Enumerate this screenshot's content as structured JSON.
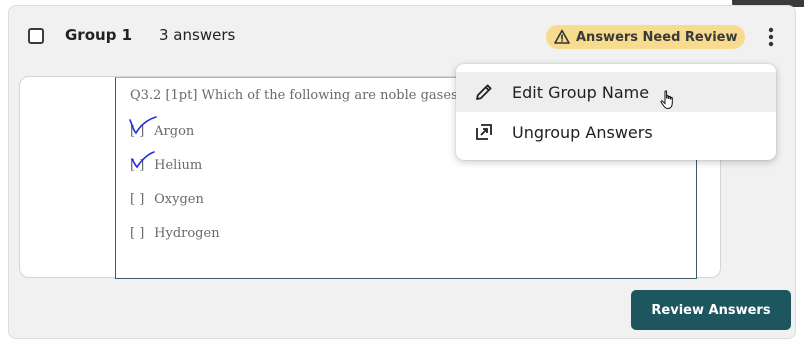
{
  "group": {
    "name": "Group 1",
    "answer_count": "3 answers",
    "status_badge": "Answers Need Review"
  },
  "answer": {
    "question": "Q3.2 [1pt]  Which of the following are noble gases?",
    "options": [
      {
        "box": "[ ]",
        "label": "Argon",
        "checked": true
      },
      {
        "box": "[ ]",
        "label": "Helium",
        "checked": true
      },
      {
        "box": "[ ]",
        "label": "Oxygen",
        "checked": false
      },
      {
        "box": "[ ]",
        "label": "Hydrogen",
        "checked": false
      }
    ]
  },
  "menu": {
    "items": [
      {
        "label": "Edit Group Name",
        "icon": "pencil-icon"
      },
      {
        "label": "Ungroup Answers",
        "icon": "ungroup-icon"
      }
    ]
  },
  "actions": {
    "review_label": "Review Answers"
  },
  "colors": {
    "badge_bg": "#f7dc8f",
    "primary_button": "#1e5660",
    "handwriting": "#1f2fd6"
  }
}
